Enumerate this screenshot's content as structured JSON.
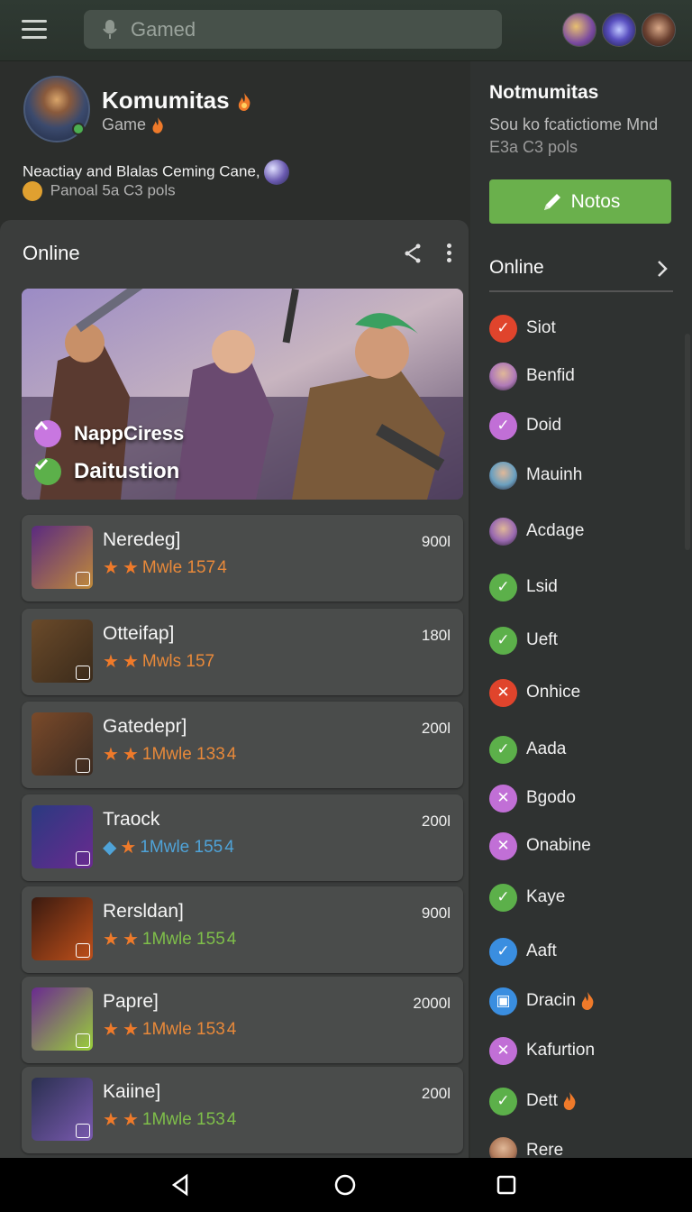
{
  "search": {
    "placeholder": "Gamed"
  },
  "community": {
    "title": "Komumitas",
    "subtitle": "Game",
    "description": "Neactiay and Blalas Ceming Cane,",
    "stats": "Panoal 5a C3 pols"
  },
  "left_panel": {
    "title": "Online",
    "hero": {
      "line1": "NappCiress",
      "line2": "Daitustion"
    },
    "games": [
      {
        "name": "Neredeg]",
        "count": "900l",
        "meta": "Mwle 157",
        "meta_color": "#e8893a",
        "tail": "4",
        "first_star": "star",
        "thumb_colors": [
          "#5a2a80",
          "#c08a3a"
        ]
      },
      {
        "name": "Otteifap]",
        "count": "180l",
        "meta": "Mwls 157",
        "meta_color": "#e8893a",
        "tail": "",
        "first_star": "star",
        "thumb_colors": [
          "#6a4a2a",
          "#3a2a1a"
        ]
      },
      {
        "name": "Gatedepr]",
        "count": "200l",
        "meta": "1Mwle 133",
        "meta_color": "#e8893a",
        "tail": "4",
        "first_star": "star",
        "thumb_colors": [
          "#7a4a2a",
          "#3a2a20"
        ]
      },
      {
        "name": "Traock",
        "count": "200l",
        "meta": "1Mwle 155",
        "meta_color": "#4fa3d8",
        "tail": "4",
        "first_star": "diamond",
        "thumb_colors": [
          "#2a3a80",
          "#6a2a90"
        ]
      },
      {
        "name": "Rersldan]",
        "count": "900l",
        "meta": "1Mwle 155",
        "meta_color": "#7fbf4a",
        "tail": "4",
        "first_star": "star",
        "thumb_colors": [
          "#3a1a10",
          "#c0501a"
        ]
      },
      {
        "name": "Papre]",
        "count": "2000l",
        "meta": "1Mwle 153",
        "meta_color": "#e8893a",
        "tail": "4",
        "first_star": "star",
        "thumb_colors": [
          "#6a2a90",
          "#9ad03a"
        ]
      },
      {
        "name": "Kaiine]",
        "count": "200l",
        "meta": "1Mwle 153",
        "meta_color": "#7fbf4a",
        "tail": "4",
        "first_star": "star",
        "thumb_colors": [
          "#2a3050",
          "#7a5ab0"
        ]
      }
    ]
  },
  "right_panel": {
    "title": "Notmumitas",
    "desc_line1": "Sou ko fcatictiome Mnd",
    "desc_line2": "E3a C3 pols",
    "button_label": "Notos",
    "section_title": "Online",
    "members": [
      {
        "label": "Siot",
        "icon": "check-red",
        "color": "#e0442c",
        "flame": false
      },
      {
        "label": "Benfid",
        "icon": "avatar",
        "color": "#b07ab8",
        "flame": false
      },
      {
        "label": "Doid",
        "icon": "check-purple",
        "color": "#c16fd6",
        "flame": false
      },
      {
        "label": "Mauinh",
        "icon": "avatar",
        "color": "#6aa0c0",
        "flame": false
      },
      {
        "label": "Acdage",
        "icon": "avatar",
        "color": "#9a6ab0",
        "flame": false
      },
      {
        "label": "Lsid",
        "icon": "check-green",
        "color": "#5cb04a",
        "flame": false
      },
      {
        "label": "Ueft",
        "icon": "check-green",
        "color": "#5cb04a",
        "flame": false
      },
      {
        "label": "Onhice",
        "icon": "cross-red",
        "color": "#e0442c",
        "flame": false
      },
      {
        "label": "Aada",
        "icon": "check-green",
        "color": "#5cb04a",
        "flame": false
      },
      {
        "label": "Bgodo",
        "icon": "cross-purple",
        "color": "#c16fd6",
        "flame": false
      },
      {
        "label": "Onabine",
        "icon": "cross-purple",
        "color": "#c16fd6",
        "flame": false
      },
      {
        "label": "Kaye",
        "icon": "check-green",
        "color": "#5cb04a",
        "flame": false
      },
      {
        "label": "Aaft",
        "icon": "check-blue",
        "color": "#3a8ee0",
        "flame": false
      },
      {
        "label": "Dracin",
        "icon": "square-blue",
        "color": "#3a8ee0",
        "flame": true
      },
      {
        "label": "Kafurtion",
        "icon": "cross-purple",
        "color": "#c16fd6",
        "flame": false
      },
      {
        "label": "Dett",
        "icon": "check-green",
        "color": "#5cb04a",
        "flame": true
      },
      {
        "label": "Rere",
        "icon": "avatar",
        "color": "#b07a5a",
        "flame": false
      }
    ]
  },
  "colors": {
    "accent_green": "#6ab04c",
    "flame_orange": "#ef7a2a",
    "background": "#2c2e2c"
  }
}
